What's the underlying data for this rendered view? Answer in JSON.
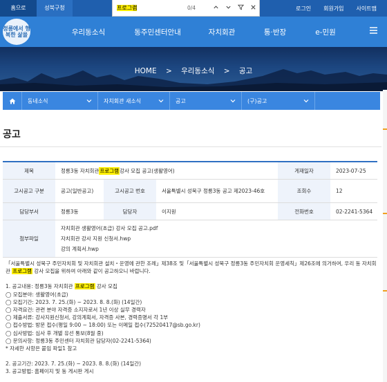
{
  "topbar": {
    "home": "홈으로",
    "district": "성북구청",
    "links": [
      "로그인",
      "회원가입",
      "사이트맵"
    ]
  },
  "findbar": {
    "query": "프로그램",
    "count": "0/4",
    "icons": [
      "chevron-up-icon",
      "chevron-down-icon",
      "filter-icon",
      "close-icon"
    ]
  },
  "logo": {
    "text": "정릉에서 행복한 삶을"
  },
  "gnb": {
    "items": [
      "우리동소식",
      "동주민센터안내",
      "자치회관",
      "통·반장",
      "e-민원"
    ]
  },
  "breadcrumb": {
    "items": [
      "HOME",
      "우리동소식",
      "공고"
    ],
    "separator": ">"
  },
  "subnav": {
    "items": [
      "동네소식",
      "자치회관 새소식",
      "공고",
      "(구)공고"
    ]
  },
  "page": {
    "title": "공고"
  },
  "notice": {
    "labels": {
      "title": "제목",
      "posted": "게재일자",
      "category": "고시공고 구분",
      "number": "고시공고 번호",
      "views": "조회수",
      "dept": "담당부서",
      "officer": "담당자",
      "phone": "전화번호",
      "attachments": "첨부파일"
    },
    "title_pre": "정릉3동 자치회관 ",
    "title_hl": "프로그램",
    "title_post": " 강사 모집 공고(생활영어)",
    "posted": "2023-07-25",
    "category": "공고(일반공고)",
    "number": "서울특별시 성북구 정릉3동 공고 제2023-46호",
    "views": "12",
    "dept": "정릉3동",
    "officer": "이지원",
    "phone": "02-2241-5364",
    "attachments": [
      "자치회관 생활영어(초급) 강사 모집 공고.pdf",
      "자치회관 강사 지원 신청서.hwp",
      "강의 계획서.hwp"
    ]
  },
  "body": {
    "intro1": "「서울특별시 성북구 주민자치회 및 자치회관 설치・운영에 관한 조례」제38조 및「서울특별시 성북구 정릉3동 주민자치회 운영세칙」제26조에 의거하여, 우리 동 자치회",
    "intro2_pre": "관 ",
    "intro2_hl": "프로그램",
    "intro2_post": " 강사 모집을 위하여 아래와 같이 공고하오니 바랍니다.",
    "s1_pre": "1. 공고내용: 정릉3동 자치회관 ",
    "s1_hl": "프로그램",
    "s1_post": " 강사 모집",
    "items": [
      "◯ 모집분야: 생활영어(초급)",
      "◯ 모집기간: 2023. 7. 25.(화) ~ 2023. 8. 8.(화) (14일간)",
      "◯ 자격요건: 관련 분야 자격증 소지자로서 1년 이상 실무 경력자",
      "◯ 제출서류: 강사지원신청서, 강의계획서, 자격증 사본, 경력증명서 각 1부",
      "◯ 접수방법: 방문 접수(평일 9:00 ~ 18:00) 또는 이메일 접수(72520417@sb.go.kr)",
      "◯ 심사방법: 심사 후 개별 유선 통보(8월 중)",
      "◯ 문의사항: 정릉3동 주민센터 자치회관 담당자(02-2241-5364)"
    ],
    "note": "* 자세한 사항은 붙임 파일1 참고",
    "s2": "2. 공고기간: 2023. 7. 25.(화) ~ 2023. 8. 8.(화) (14일간)",
    "s3": "3. 공고방법: 홈페이지 및 동 게시판 게시"
  },
  "colors": {
    "topbar": "#1f5fae",
    "header": "#2f80d6",
    "subnav": "#3a86e0",
    "highlight": "#ffef00",
    "table_border": "#2e6fc2"
  }
}
